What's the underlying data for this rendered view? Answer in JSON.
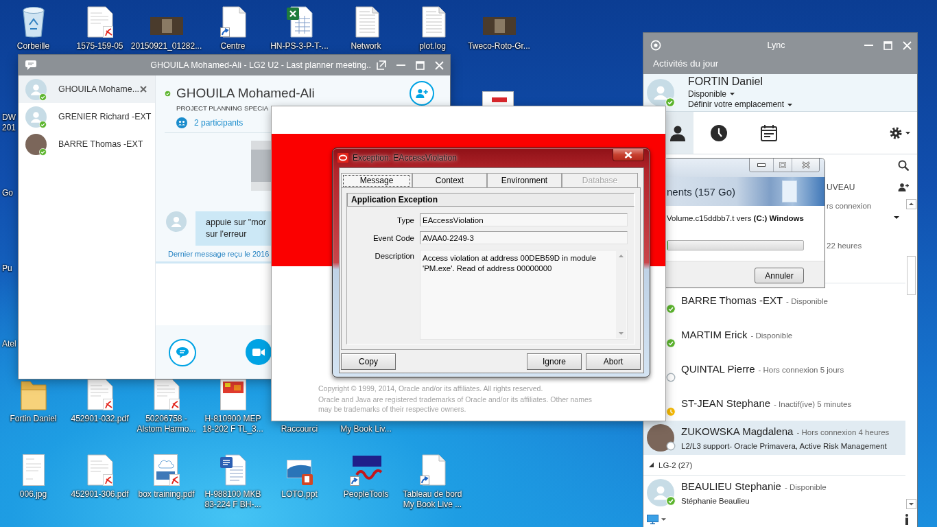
{
  "desktop": {
    "left_column": [
      {
        "lines": [
          "DW",
          "201"
        ]
      },
      {
        "lines": [
          "Go"
        ]
      },
      {
        "lines": [
          "Pu"
        ]
      },
      {
        "lines": [
          "Atel"
        ]
      }
    ],
    "rows": [
      [
        {
          "kind": "recycle-bin",
          "lines": [
            "Corbeille"
          ]
        },
        {
          "kind": "pdf",
          "lines": [
            "1575-159-05"
          ]
        },
        {
          "kind": "photo",
          "lines": [
            "20150921_01282..."
          ]
        },
        {
          "kind": "shortcut",
          "lines": [
            "Centre"
          ]
        },
        {
          "kind": "spreadsheet",
          "lines": [
            "HN-PS-3-P-T-..."
          ]
        },
        {
          "kind": "text",
          "lines": [
            "Network"
          ]
        },
        {
          "kind": "text",
          "lines": [
            "plot.log"
          ]
        },
        {
          "kind": "photo",
          "lines": [
            "Tweco-Roto-Gr..."
          ]
        }
      ],
      [
        {
          "kind": "folder",
          "lines": [
            "Fortin Daniel"
          ]
        },
        {
          "kind": "pdf",
          "lines": [
            "452901-032.pdf"
          ]
        },
        {
          "kind": "pdf",
          "lines": [
            "50206758 -",
            "Alstom Harmo..."
          ]
        },
        {
          "kind": "image",
          "lines": [
            "H-810900 MEP",
            "18-202 F TL_3..."
          ]
        },
        {
          "kind": "covered",
          "lines": [
            "Raccourci"
          ]
        },
        {
          "kind": "covered",
          "lines": [
            "My Book Liv..."
          ]
        }
      ],
      [
        {
          "kind": "scan",
          "lines": [
            "006.jpg"
          ]
        },
        {
          "kind": "pdf",
          "lines": [
            "452901-306.pdf"
          ]
        },
        {
          "kind": "cloud-pdf",
          "lines": [
            "box training.pdf"
          ]
        },
        {
          "kind": "document",
          "lines": [
            "H-988100 MKB",
            "83-224 F BH-..."
          ]
        },
        {
          "kind": "presentation",
          "lines": [
            "LOTO.ppt"
          ]
        },
        {
          "kind": "logo",
          "lines": [
            "PeopleTools"
          ]
        },
        {
          "kind": "shortcut",
          "lines": [
            "Tableau de bord",
            "My Book Live ..."
          ]
        }
      ]
    ]
  },
  "chat_window": {
    "title": "GHOUILA Mohamed-Ali - LG2 U2 - Last planner meeting..",
    "conversations": [
      {
        "name": "GHOUILA Mohame...",
        "avatar": {
          "kind": "generic"
        },
        "presence": {
          "kind": "available"
        },
        "selected": true
      },
      {
        "name": "GRENIER Richard -EXT",
        "avatar": {
          "kind": "generic"
        },
        "presence": {
          "kind": "available"
        },
        "selected": false
      },
      {
        "name": "BARRE Thomas -EXT",
        "avatar": {
          "kind": "photo"
        },
        "presence": {
          "kind": "available"
        },
        "selected": false
      }
    ],
    "contact": {
      "name": "GHOUILA Mohamed-Ali",
      "presence": {
        "kind": "available"
      },
      "job_title": "PROJECT PLANNING SPECIA",
      "participants": "2 participants"
    },
    "message": {
      "lines": [
        "appuie sur \"mor",
        "sur l'erreur"
      ]
    },
    "last_received": "Dernier message reçu le 2016"
  },
  "splash_window": {
    "copyright": "Copyright © 1999, 2014, Oracle and/or its affiliates. All rights reserved.",
    "trademark": "Oracle and Java are registered trademarks of Oracle and/or its affiliates. Other names may be trademarks of their respective owners."
  },
  "exception_dialog": {
    "title": "Exception: EAccessViolation",
    "tabs": [
      {
        "label": "Message",
        "selected": true,
        "disabled": false
      },
      {
        "label": "Context",
        "selected": false,
        "disabled": false
      },
      {
        "label": "Environment",
        "selected": false,
        "disabled": false
      },
      {
        "label": "Database",
        "selected": false,
        "disabled": true
      }
    ],
    "section": "Application Exception",
    "fields": [
      {
        "label": "Type",
        "value": "EAccessViolation"
      },
      {
        "label": "Event Code",
        "value": "AVAA0-2249-3"
      }
    ],
    "description": {
      "label": "Description",
      "value": "Access violation at address 00DEB59D in module 'PM.exe'. Read of address 00000000"
    },
    "buttons": [
      "Copy",
      "Ignore",
      "Abort"
    ]
  },
  "copy_dialog": {
    "heading": "nents (157 Go)",
    "detail": "Volume.c15ddbb7.t vers **(C:) Windows**",
    "progress": {
      "level": 0
    },
    "button": "Annuler"
  },
  "lync_window": {
    "title": "Lync",
    "activities": "Activités du jour",
    "user": {
      "name": "FORTIN Daniel",
      "presence": {
        "kind": "available"
      },
      "presence_label": "Disponible",
      "location": "Définir votre emplacement"
    },
    "tabs": [
      {
        "kind": "contacts",
        "selected": true
      },
      {
        "kind": "history",
        "selected": false
      },
      {
        "kind": "meetings",
        "selected": false
      }
    ],
    "clipped_group": {
      "label": "UVEAU"
    },
    "clipped_rows": [
      {
        "kind": "menu",
        "status_text": "rs connexion"
      },
      {
        "kind": "plain",
        "status_text": "22 heures"
      }
    ],
    "contacts": [
      {
        "name": "BARRE Thomas -EXT",
        "status_text": "- Disponible",
        "presence": {
          "kind": "available"
        },
        "selected": false
      },
      {
        "name": "MARTIM Erick",
        "status_text": "- Disponible",
        "presence": {
          "kind": "available"
        },
        "selected": false
      },
      {
        "name": "QUINTAL Pierre",
        "status_text": "- Hors connexion 5 jours",
        "presence": {
          "kind": "offline"
        },
        "selected": false
      },
      {
        "name": "ST-JEAN Stephane",
        "status_text": "- Inactif(ive) 5 minutes",
        "presence": {
          "kind": "away"
        },
        "selected": false
      },
      {
        "name": "ZUKOWSKA Magdalena",
        "status_text": "- Hors connexion 4 heures",
        "presence": {
          "kind": "offline"
        },
        "avatar": {
          "kind": "photo"
        },
        "note": "L2/L3 support- Oracle Primavera, Active Risk Management",
        "selected": true
      }
    ],
    "group": {
      "label": "LG-2 (27)",
      "expanded": true,
      "contacts": [
        {
          "name": "BEAULIEU Stephanie",
          "status_text": "- Disponible",
          "presence": {
            "kind": "available"
          },
          "avatar": {
            "kind": "generic"
          },
          "note": "Stéphanie Beaulieu",
          "selected": false
        }
      ]
    }
  }
}
